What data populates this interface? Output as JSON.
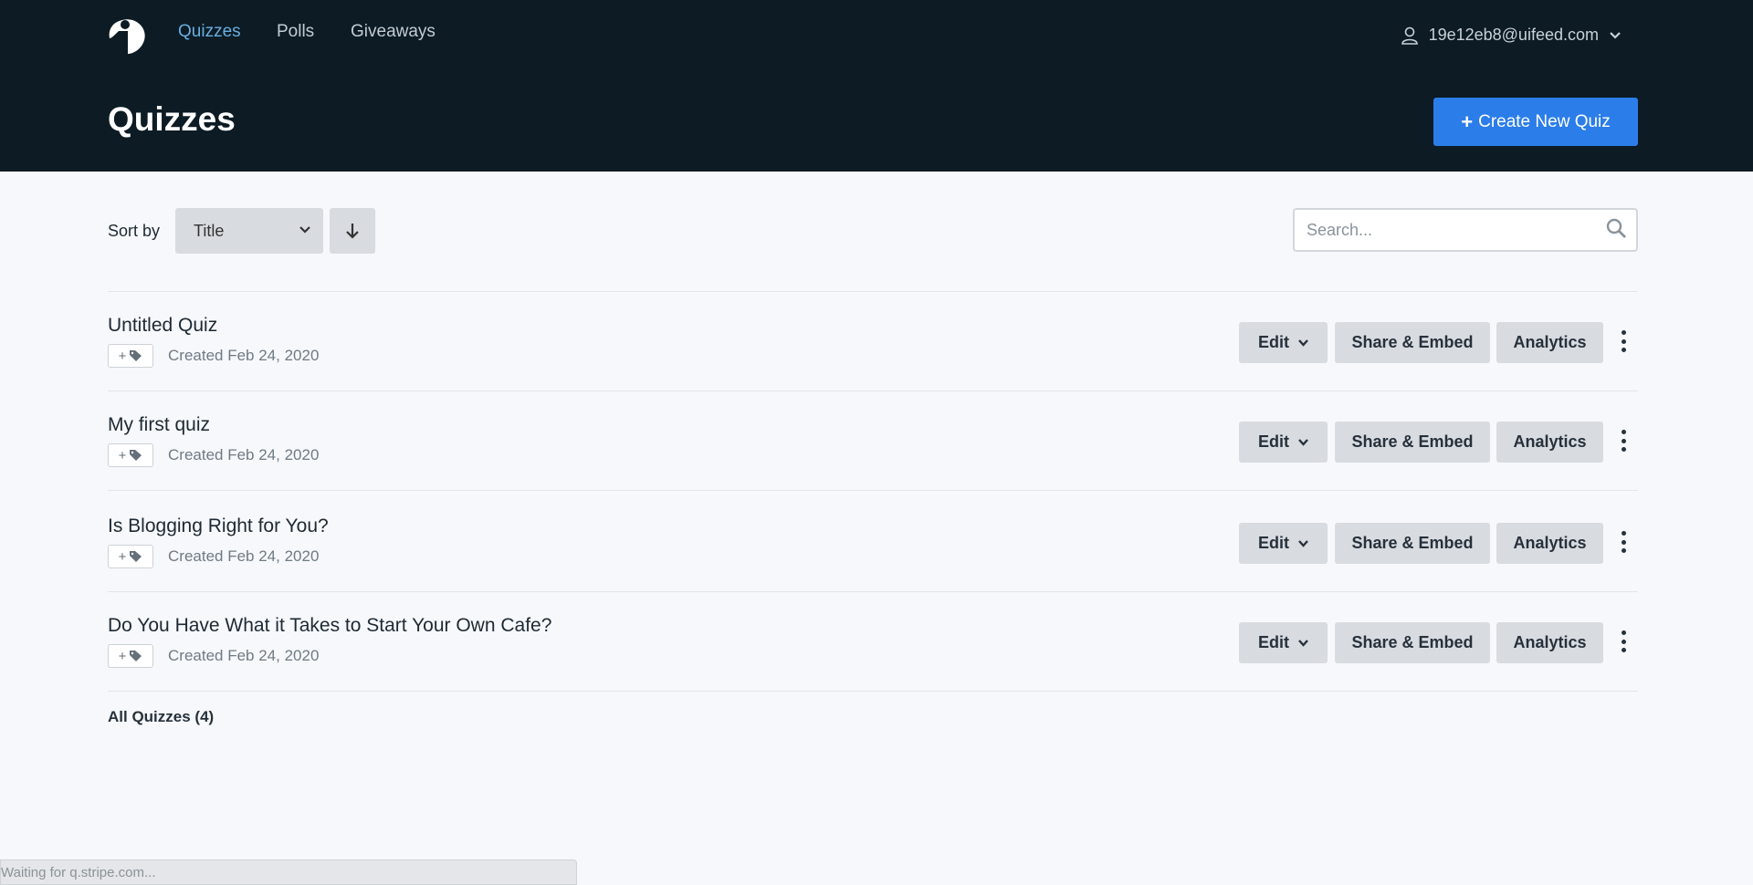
{
  "header": {
    "nav": [
      {
        "label": "Quizzes",
        "active": true
      },
      {
        "label": "Polls"
      },
      {
        "label": "Giveaways"
      }
    ],
    "user_email": "19e12eb8@uifeed.com",
    "page_title": "Quizzes",
    "create_label": "Create New Quiz"
  },
  "toolbar": {
    "sort_label": "Sort by",
    "sort_value": "Title",
    "search_placeholder": "Search..."
  },
  "quizzes": [
    {
      "title": "Untitled Quiz",
      "created": "Created Feb 24, 2020"
    },
    {
      "title": "My first quiz",
      "created": "Created Feb 24, 2020"
    },
    {
      "title": "Is Blogging Right for You?",
      "created": "Created Feb 24, 2020"
    },
    {
      "title": "Do You Have What it Takes to Start Your Own Cafe?",
      "created": "Created Feb 24, 2020"
    }
  ],
  "row_actions": {
    "edit": "Edit",
    "share": "Share & Embed",
    "analytics": "Analytics"
  },
  "footer": "All Quizzes (4)",
  "status_bar": "Waiting for q.stripe.com...",
  "colors": {
    "header_bg": "#0c1b24",
    "accent": "#2b7de9",
    "active_nav": "#6aaee0"
  }
}
